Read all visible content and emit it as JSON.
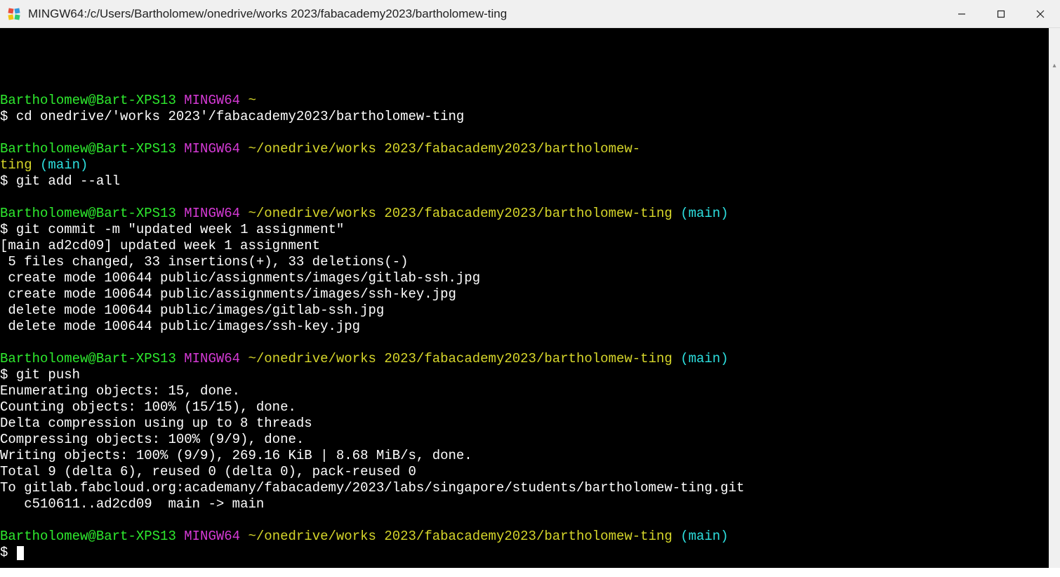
{
  "window": {
    "title": "MINGW64:/c/Users/Bartholomew/onedrive/works 2023/fabacademy2023/bartholomew-ting"
  },
  "prompts": {
    "user_host": "Bartholomew@Bart-XPS13",
    "shell": "MINGW64",
    "path_home": "~",
    "path_long_wrap1": "~/onedrive/works 2023/fabacademy2023/bartholomew-",
    "path_long_wrap2": "ting",
    "path_full": "~/onedrive/works 2023/fabacademy2023/bartholomew-ting",
    "branch": "(main)",
    "dollar": "$ "
  },
  "commands": {
    "cd": "cd onedrive/'works 2023'/fabacademy2023/bartholomew-ting",
    "git_add": "git add --all",
    "git_commit": "git commit -m \"updated week 1 assignment\"",
    "git_push": "git push"
  },
  "output": {
    "commit1": "[main ad2cd09] updated week 1 assignment",
    "commit2": " 5 files changed, 33 insertions(+), 33 deletions(-)",
    "commit3": " create mode 100644 public/assignments/images/gitlab-ssh.jpg",
    "commit4": " create mode 100644 public/assignments/images/ssh-key.jpg",
    "commit5": " delete mode 100644 public/images/gitlab-ssh.jpg",
    "commit6": " delete mode 100644 public/images/ssh-key.jpg",
    "push1": "Enumerating objects: 15, done.",
    "push2": "Counting objects: 100% (15/15), done.",
    "push3": "Delta compression using up to 8 threads",
    "push4": "Compressing objects: 100% (9/9), done.",
    "push5": "Writing objects: 100% (9/9), 269.16 KiB | 8.68 MiB/s, done.",
    "push6": "Total 9 (delta 6), reused 0 (delta 0), pack-reused 0",
    "push7": "To gitlab.fabcloud.org:academany/fabacademy/2023/labs/singapore/students/bartholomew-ting.git",
    "push8": "   c510611..ad2cd09  main -> main"
  }
}
